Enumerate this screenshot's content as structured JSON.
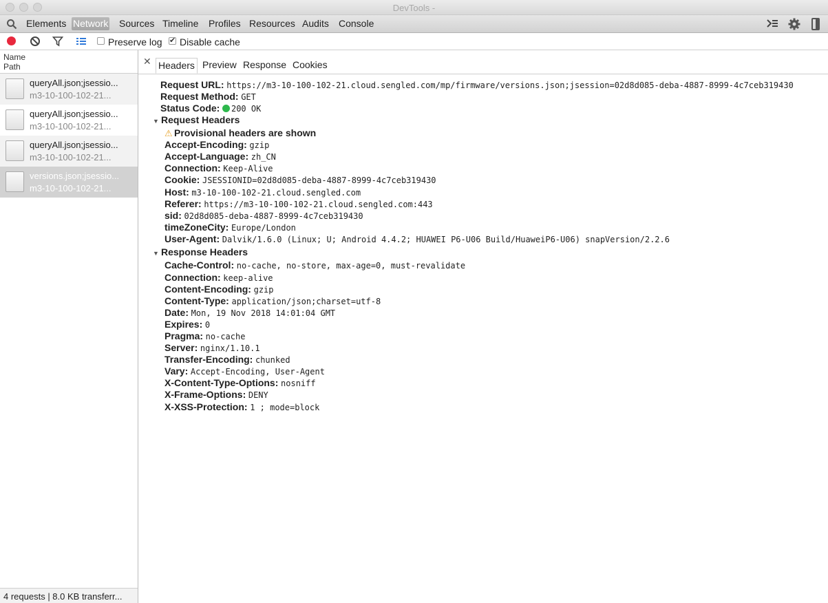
{
  "window": {
    "title": "DevTools -"
  },
  "toolbar": {
    "tabs": [
      "Elements",
      "Network",
      "Sources",
      "Timeline",
      "Profiles",
      "Resources",
      "Audits",
      "Console"
    ],
    "selected_tab": "Network"
  },
  "network_toolbar": {
    "preserve_log_label": "Preserve log",
    "preserve_log_checked": false,
    "disable_cache_label": "Disable cache",
    "disable_cache_checked": true
  },
  "requests": {
    "header_name": "Name",
    "header_path": "Path",
    "items": [
      {
        "name": "queryAll.json;jsessio...",
        "path": "m3-10-100-102-21..."
      },
      {
        "name": "queryAll.json;jsessio...",
        "path": "m3-10-100-102-21..."
      },
      {
        "name": "queryAll.json;jsessio...",
        "path": "m3-10-100-102-21..."
      },
      {
        "name": "versions.json;jsessio...",
        "path": "m3-10-100-102-21..."
      }
    ],
    "footer": "4 requests | 8.0 KB transferr..."
  },
  "detail_tabs": [
    "Headers",
    "Preview",
    "Response",
    "Cookies"
  ],
  "general": [
    {
      "key": "Request URL:",
      "value": "https://m3-10-100-102-21.cloud.sengled.com/mp/firmware/versions.json;jsession=02d8d085-deba-4887-8999-4c7ceb319430"
    },
    {
      "key": "Request Method:",
      "value": "GET"
    },
    {
      "key": "Status Code:",
      "value": "200 OK"
    }
  ],
  "request_headers": {
    "title": "Request Headers",
    "warning": "Provisional headers are shown",
    "items": [
      {
        "key": "Accept-Encoding:",
        "value": "gzip"
      },
      {
        "key": "Accept-Language:",
        "value": "zh_CN"
      },
      {
        "key": "Connection:",
        "value": "Keep-Alive"
      },
      {
        "key": "Cookie:",
        "value": "JSESSIONID=02d8d085-deba-4887-8999-4c7ceb319430"
      },
      {
        "key": "Host:",
        "value": "m3-10-100-102-21.cloud.sengled.com"
      },
      {
        "key": "Referer:",
        "value": "https://m3-10-100-102-21.cloud.sengled.com:443"
      },
      {
        "key": "sid:",
        "value": "02d8d085-deba-4887-8999-4c7ceb319430"
      },
      {
        "key": "timeZoneCity:",
        "value": "Europe/London"
      },
      {
        "key": "User-Agent:",
        "value": "Dalvik/1.6.0 (Linux; U; Android 4.4.2; HUAWEI P6-U06 Build/HuaweiP6-U06) snapVersion/2.2.6"
      }
    ]
  },
  "response_headers": {
    "title": "Response Headers",
    "items": [
      {
        "key": "Cache-Control:",
        "value": "no-cache, no-store, max-age=0, must-revalidate"
      },
      {
        "key": "Connection:",
        "value": "keep-alive"
      },
      {
        "key": "Content-Encoding:",
        "value": "gzip"
      },
      {
        "key": "Content-Type:",
        "value": "application/json;charset=utf-8"
      },
      {
        "key": "Date:",
        "value": "Mon, 19 Nov 2018 14:01:04 GMT"
      },
      {
        "key": "Expires:",
        "value": "0"
      },
      {
        "key": "Pragma:",
        "value": "no-cache"
      },
      {
        "key": "Server:",
        "value": "nginx/1.10.1"
      },
      {
        "key": "Transfer-Encoding:",
        "value": "chunked"
      },
      {
        "key": "Vary:",
        "value": "Accept-Encoding, User-Agent"
      },
      {
        "key": "X-Content-Type-Options:",
        "value": "nosniff"
      },
      {
        "key": "X-Frame-Options:",
        "value": "DENY"
      },
      {
        "key": "X-XSS-Protection:",
        "value": "1 ; mode=block"
      }
    ]
  },
  "colors": {
    "record": "#e8283d",
    "status_ok": "#2db84c",
    "warning": "#e7a42d",
    "accent_blue": "#2f79d9"
  },
  "icons": [
    "search-icon",
    "record-icon",
    "clear-icon",
    "filter-icon",
    "list-view-icon",
    "drawer-icon",
    "gear-icon",
    "dock-icon",
    "close-icon",
    "file-icon",
    "warning-icon",
    "expand-triangle-icon",
    "status-dot-icon"
  ]
}
